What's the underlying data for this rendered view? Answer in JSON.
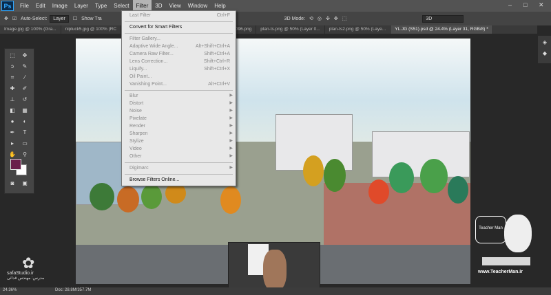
{
  "app": {
    "logo": "Ps"
  },
  "menubar": {
    "items": [
      "File",
      "Edit",
      "Image",
      "Layer",
      "Type",
      "Select",
      "Filter",
      "3D",
      "View",
      "Window",
      "Help"
    ],
    "active": "Filter"
  },
  "window_controls": {
    "minimize": "–",
    "maximize": "□",
    "close": "✕"
  },
  "options_bar": {
    "auto_select_label": "Auto-Select:",
    "auto_select_value": "Layer",
    "show_transform_label": "Show Tra",
    "mode_label": "3D Mode:",
    "workspace": "3D"
  },
  "tabs": [
    {
      "label": "Image.jpg @ 100% (Gra...",
      "active": false
    },
    {
      "label": "nipluck5.jpg @ 100% (RC",
      "active": false
    },
    {
      "label": "1 - 2013 - 096.png",
      "active": false
    },
    {
      "label": "plan-ts.png @ 50% (Layer 0...",
      "active": false
    },
    {
      "label": "plan-ts2.png @ 50% (Laye...",
      "active": false
    },
    {
      "label": "YL.JG (S51).psd @ 24.4% (Layer 31, RGB/8) *",
      "active": true
    }
  ],
  "filter_menu": {
    "items": [
      {
        "label": "Last Filter",
        "shortcut": "Ctrl+F",
        "disabled": true
      },
      {
        "label": "Convert for Smart Filters",
        "shortcut": "",
        "disabled": false
      },
      {
        "label": "Filter Gallery...",
        "shortcut": "",
        "disabled": true
      },
      {
        "label": "Adaptive Wide Angle...",
        "shortcut": "Alt+Shift+Ctrl+A",
        "disabled": true
      },
      {
        "label": "Camera Raw Filter...",
        "shortcut": "Shift+Ctrl+A",
        "disabled": true
      },
      {
        "label": "Lens Correction...",
        "shortcut": "Shift+Ctrl+R",
        "disabled": true
      },
      {
        "label": "Liquify...",
        "shortcut": "Shift+Ctrl+X",
        "disabled": true
      },
      {
        "label": "Oil Paint...",
        "shortcut": "",
        "disabled": true
      },
      {
        "label": "Vanishing Point...",
        "shortcut": "Alt+Ctrl+V",
        "disabled": true
      },
      {
        "label": "Blur",
        "submenu": true,
        "disabled": true
      },
      {
        "label": "Distort",
        "submenu": true,
        "disabled": true
      },
      {
        "label": "Noise",
        "submenu": true,
        "disabled": true
      },
      {
        "label": "Pixelate",
        "submenu": true,
        "disabled": true
      },
      {
        "label": "Render",
        "submenu": true,
        "disabled": true
      },
      {
        "label": "Sharpen",
        "submenu": true,
        "disabled": true
      },
      {
        "label": "Stylize",
        "submenu": true,
        "disabled": true
      },
      {
        "label": "Video",
        "submenu": true,
        "disabled": true
      },
      {
        "label": "Other",
        "submenu": true,
        "disabled": true
      },
      {
        "label": "Digimarc",
        "submenu": true,
        "disabled": true
      },
      {
        "label": "Browse Filters Online...",
        "shortcut": "",
        "disabled": false
      }
    ]
  },
  "status": {
    "zoom": "24.36%",
    "doc": "Doc: 28.8M/357.7M"
  },
  "branding": {
    "studio": "safaStudio.ir",
    "subtitle": "مدرس: مهندس قدائی",
    "teacher_url": "www.TeacherMan.ir",
    "teacher_name": "Teacher Man"
  },
  "colors": {
    "foreground": "#6a1e4a",
    "background": "#ffffff",
    "menu_highlight": "#b4b4b4"
  }
}
